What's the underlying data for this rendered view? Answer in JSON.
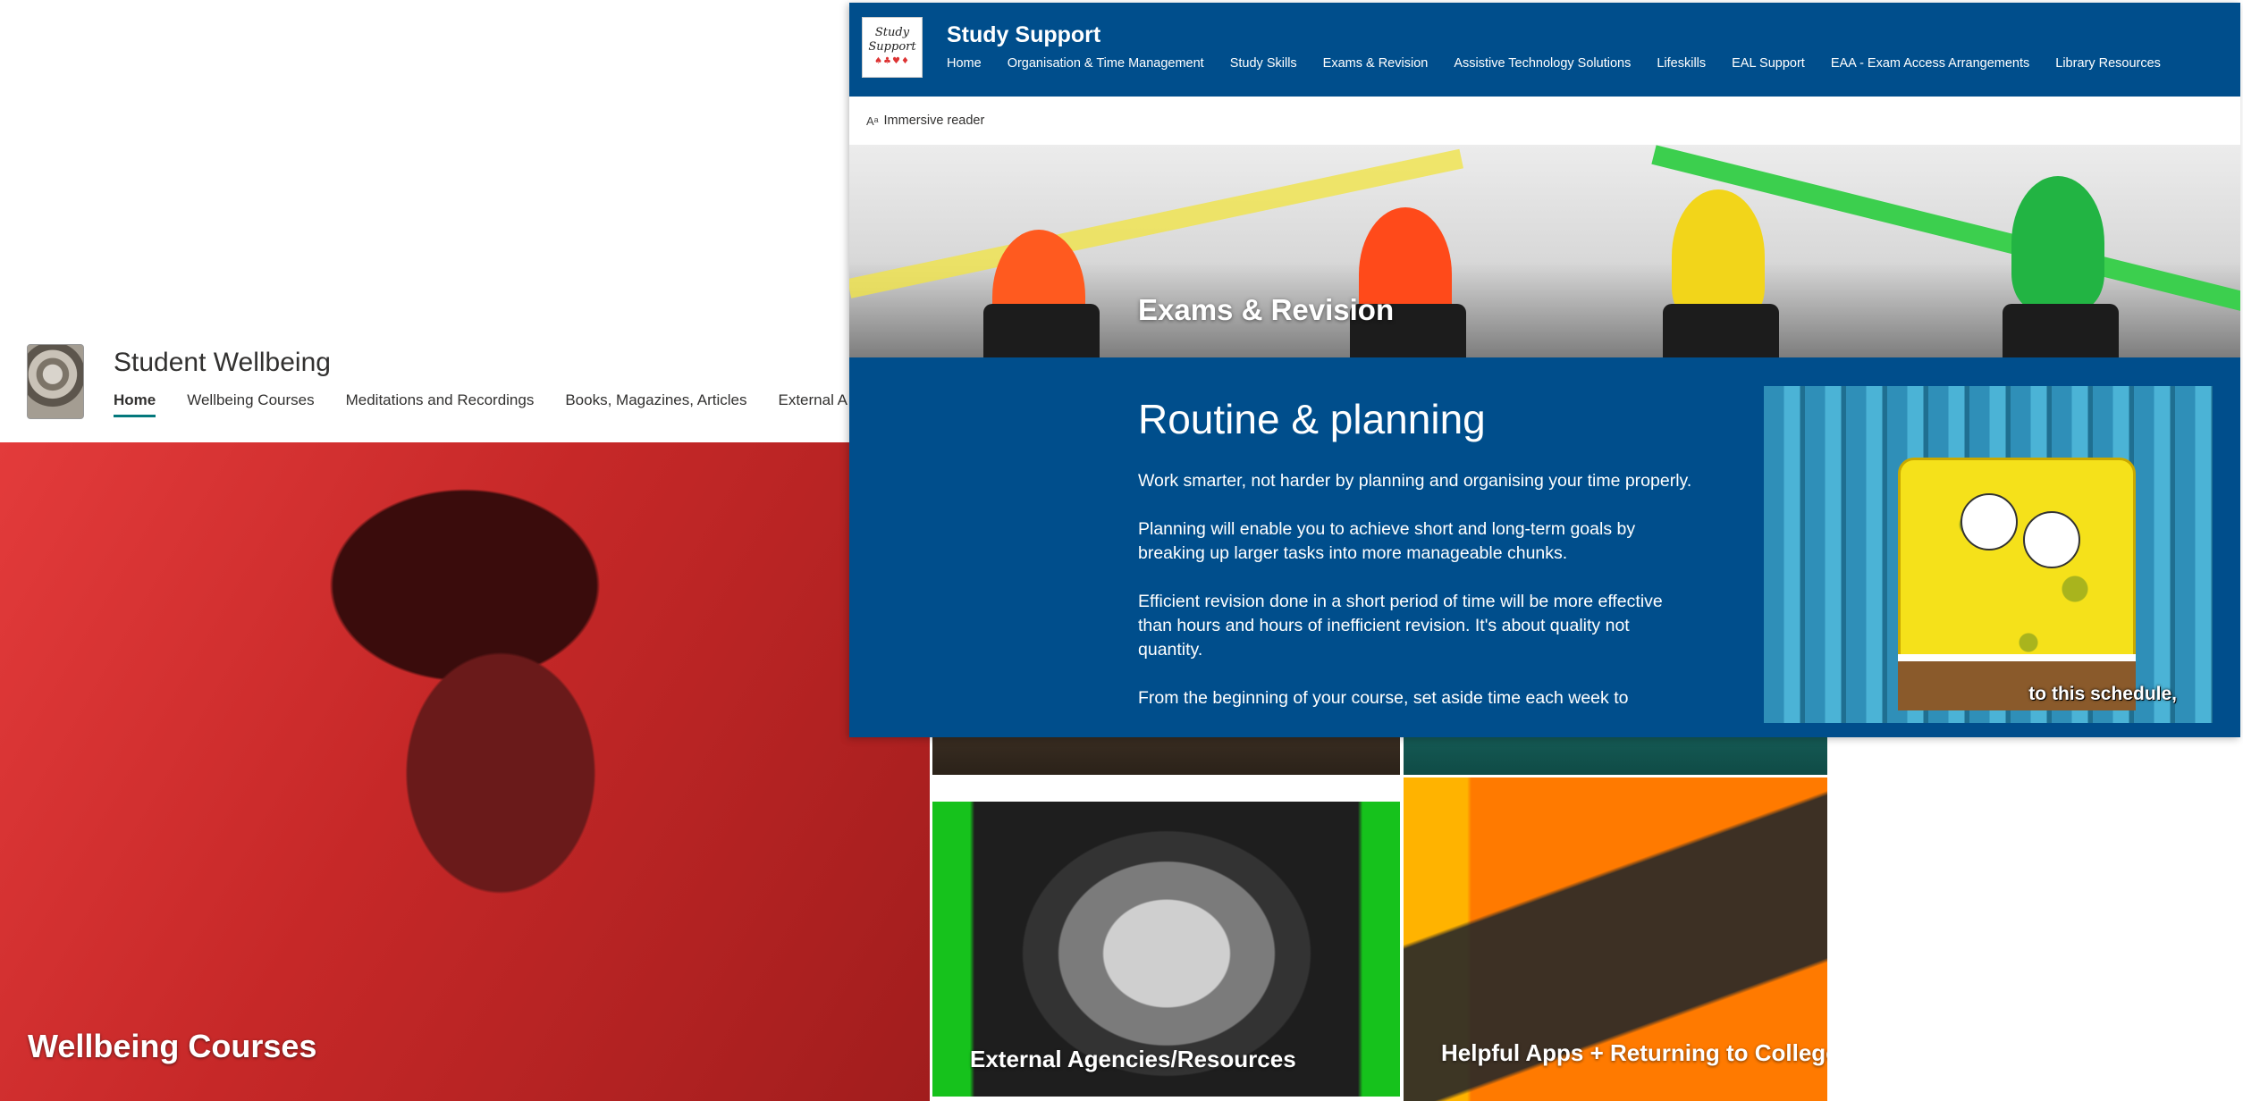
{
  "student_wellbeing": {
    "site_title": "Student Wellbeing",
    "nav": [
      {
        "label": "Home",
        "active": true
      },
      {
        "label": "Wellbeing Courses"
      },
      {
        "label": "Meditations and Recordings"
      },
      {
        "label": "Books, Magazines, Articles"
      },
      {
        "label": "External A"
      }
    ],
    "tiles": {
      "hero_caption": "Wellbeing Courses",
      "external_caption": "External Agencies/Resources",
      "apps_caption": "Helpful Apps + Returning to College"
    },
    "accent_color": "#03787c",
    "hero_color": "#c62828"
  },
  "study_support": {
    "logo_text_line1": "Study",
    "logo_text_line2": "Support",
    "site_title": "Study Support",
    "nav": [
      "Home",
      "Organisation & Time Management",
      "Study Skills",
      "Exams & Revision",
      "Assistive Technology Solutions",
      "Lifeskills",
      "EAL Support",
      "EAA - Exam Access Arrangements",
      "Library Resources"
    ],
    "immersive_reader": "Immersive reader",
    "banner_title": "Exams & Revision",
    "section_title": "Routine & planning",
    "paragraphs": [
      "Work smarter, not harder by planning and organising your time properly.",
      "Planning will enable you to achieve short and long-term goals by breaking up larger tasks into more manageable chunks.",
      "Efficient revision done in a short period of time will be more effective than hours and hours of inefficient revision. It's about quality not quantity.",
      "From the beginning of your course, set aside time each week to"
    ],
    "gif_caption": "to this schedule,",
    "theme_color": "#004e8c"
  }
}
